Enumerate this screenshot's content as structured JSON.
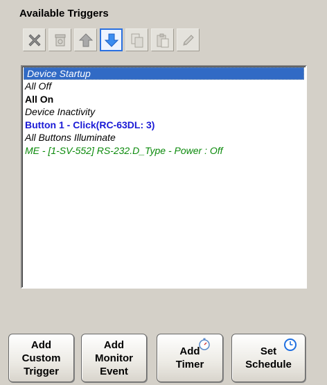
{
  "panel": {
    "title": "Available Triggers"
  },
  "toolbar": {
    "buttons": [
      {
        "name": "delete",
        "icon": "delete-x-icon",
        "enabled": true
      },
      {
        "name": "clear",
        "icon": "trash-icon",
        "enabled": false
      },
      {
        "name": "move-up",
        "icon": "arrow-up-icon",
        "enabled": true
      },
      {
        "name": "move-down",
        "icon": "arrow-down-icon",
        "enabled": true,
        "active": true
      },
      {
        "name": "copy",
        "icon": "copy-icon",
        "enabled": false
      },
      {
        "name": "paste",
        "icon": "paste-icon",
        "enabled": false
      },
      {
        "name": "edit",
        "icon": "pencil-icon",
        "enabled": false
      }
    ]
  },
  "triggers": [
    {
      "label": "Device Startup",
      "style": "selected"
    },
    {
      "label": "All Off",
      "style": "italic"
    },
    {
      "label": "All On",
      "style": "bold"
    },
    {
      "label": "Device Inactivity",
      "style": "italic"
    },
    {
      "label": "Button 1 - Click(RC-63DL: 3)",
      "style": "blue"
    },
    {
      "label": "All Buttons Illuminate",
      "style": "italic"
    },
    {
      "label": "ME - [1-SV-552] RS-232.D_Type - Power : Off",
      "style": "green"
    }
  ],
  "buttons": {
    "add_custom_trigger": [
      "Add",
      "Custom",
      "Trigger"
    ],
    "add_monitor_event": [
      "Add",
      "Monitor",
      "Event"
    ],
    "add_timer": [
      "Add",
      "Timer"
    ],
    "set_schedule": [
      "Set",
      "Schedule"
    ]
  },
  "colors": {
    "selection": "#316ac5",
    "bold_blue": "#1a1ad6",
    "green": "#0b8a0b",
    "active_border": "#2a70e0"
  }
}
